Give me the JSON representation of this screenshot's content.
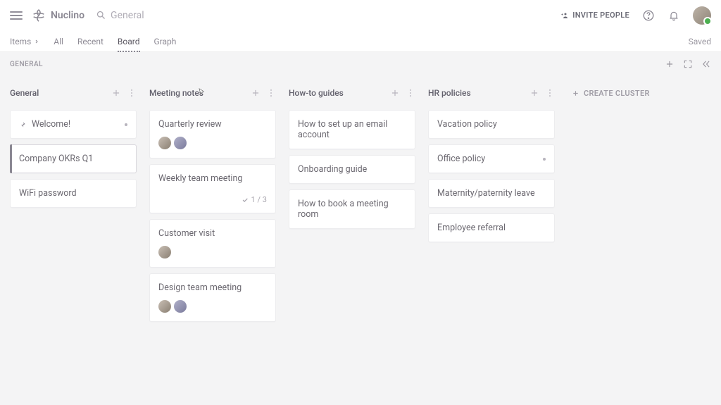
{
  "header": {
    "brand": "Nuclino",
    "search_placeholder": "General",
    "invite_label": "INVITE PEOPLE"
  },
  "nav": {
    "items_label": "Items",
    "tabs": [
      "All",
      "Recent",
      "Board",
      "Graph"
    ],
    "active_tab": "Board",
    "saved_label": "Saved"
  },
  "breadcrumb": {
    "label": "GENERAL"
  },
  "board": {
    "create_cluster_label": "CREATE CLUSTER",
    "columns": [
      {
        "title": "General",
        "cards": [
          {
            "title": "Welcome!",
            "pinned": true,
            "indicator": true
          },
          {
            "title": "Company OKRs Q1",
            "selected": true
          },
          {
            "title": "WiFi password"
          }
        ]
      },
      {
        "title": "Meeting notes",
        "cards": [
          {
            "title": "Quarterly review",
            "avatars": 2
          },
          {
            "title": "Weekly team meeting",
            "tasks": "1 / 3"
          },
          {
            "title": "Customer visit",
            "avatars": 1
          },
          {
            "title": "Design team meeting",
            "avatars": 2
          }
        ]
      },
      {
        "title": "How-to guides",
        "cards": [
          {
            "title": "How to set up an email account"
          },
          {
            "title": "Onboarding guide"
          },
          {
            "title": "How to book a meeting room"
          }
        ]
      },
      {
        "title": "HR policies",
        "cards": [
          {
            "title": "Vacation policy"
          },
          {
            "title": "Office policy",
            "indicator": true
          },
          {
            "title": "Maternity/paternity leave"
          },
          {
            "title": "Employee referral"
          }
        ]
      }
    ]
  }
}
